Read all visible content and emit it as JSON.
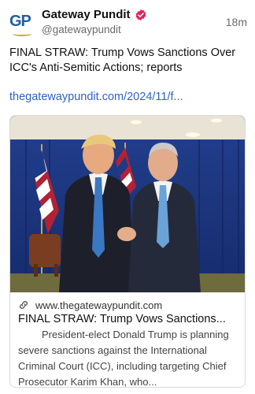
{
  "post": {
    "author_name": "Gateway Pundit",
    "author_handle": "@gatewaypundit",
    "avatar_text": "GP",
    "time_ago": "18m",
    "text": "FINAL STRAW: Trump Vows Sanctions Over ICC's Anti-Semitic Actions; reports",
    "link_text": "thegatewaypundit.com/2024/11/f..."
  },
  "card": {
    "domain": "www.thegatewaypundit.com",
    "title": "FINAL STRAW: Trump Vows Sanctions...",
    "description": "President-elect Donald Trump is planning severe sanctions against the International Criminal Court (ICC), including targeting Chief Prosecutor Karim Khan, who..."
  },
  "colors": {
    "link": "#2f63c9",
    "verified": "#e0245e",
    "avatar_brand": "#1f5fa0"
  },
  "icons": {
    "verified": "verified-badge-icon",
    "link": "link-icon"
  }
}
